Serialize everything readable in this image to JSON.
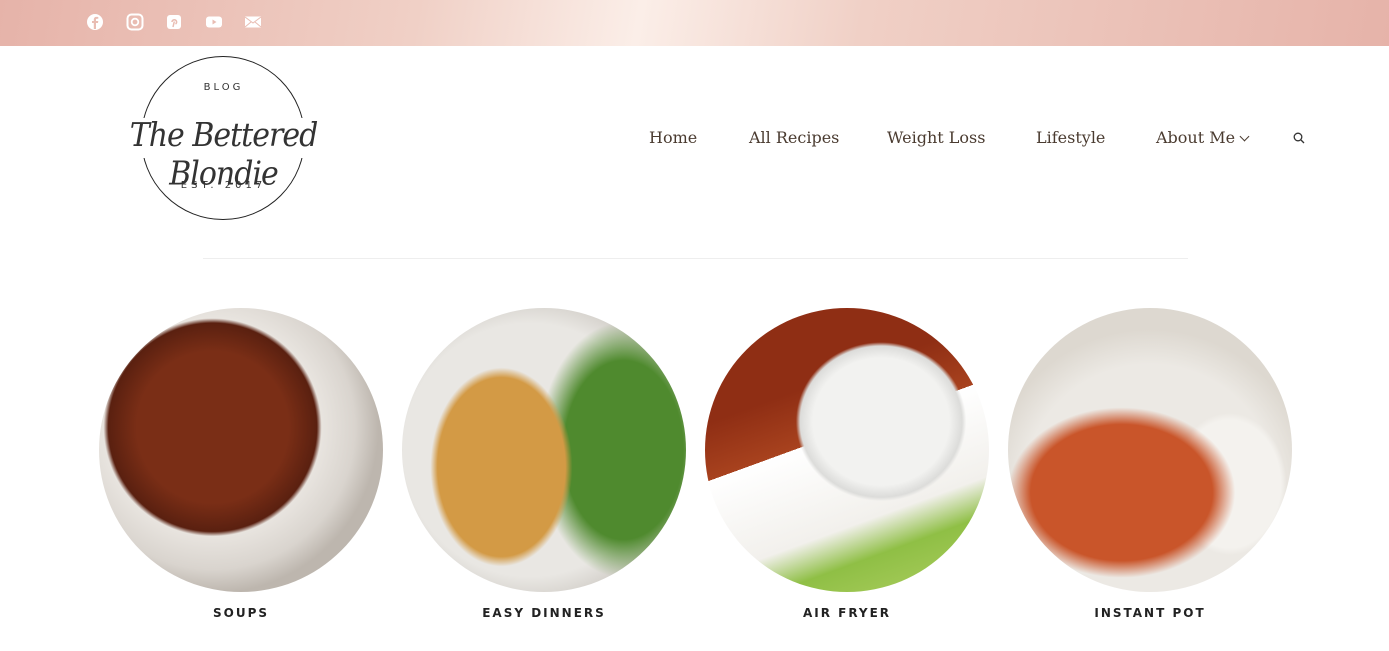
{
  "topbar": {
    "color": "#e6b3a9",
    "social": [
      {
        "icon": "facebook-icon"
      },
      {
        "icon": "instagram-icon"
      },
      {
        "icon": "pinterest-icon"
      },
      {
        "icon": "youtube-icon"
      },
      {
        "icon": "email-icon"
      }
    ]
  },
  "logo": {
    "top": "BLOG",
    "name": "The Bettered Blondie",
    "bottom": "EST. 2017"
  },
  "nav": {
    "items": [
      "Home",
      "All Recipes",
      "Weight Loss",
      "Lifestyle",
      "About Me"
    ],
    "search_icon": "search-icon"
  },
  "categories": [
    {
      "label": "SOUPS"
    },
    {
      "label": "EASY DINNERS"
    },
    {
      "label": "AIR FRYER"
    },
    {
      "label": "INSTANT POT"
    }
  ]
}
